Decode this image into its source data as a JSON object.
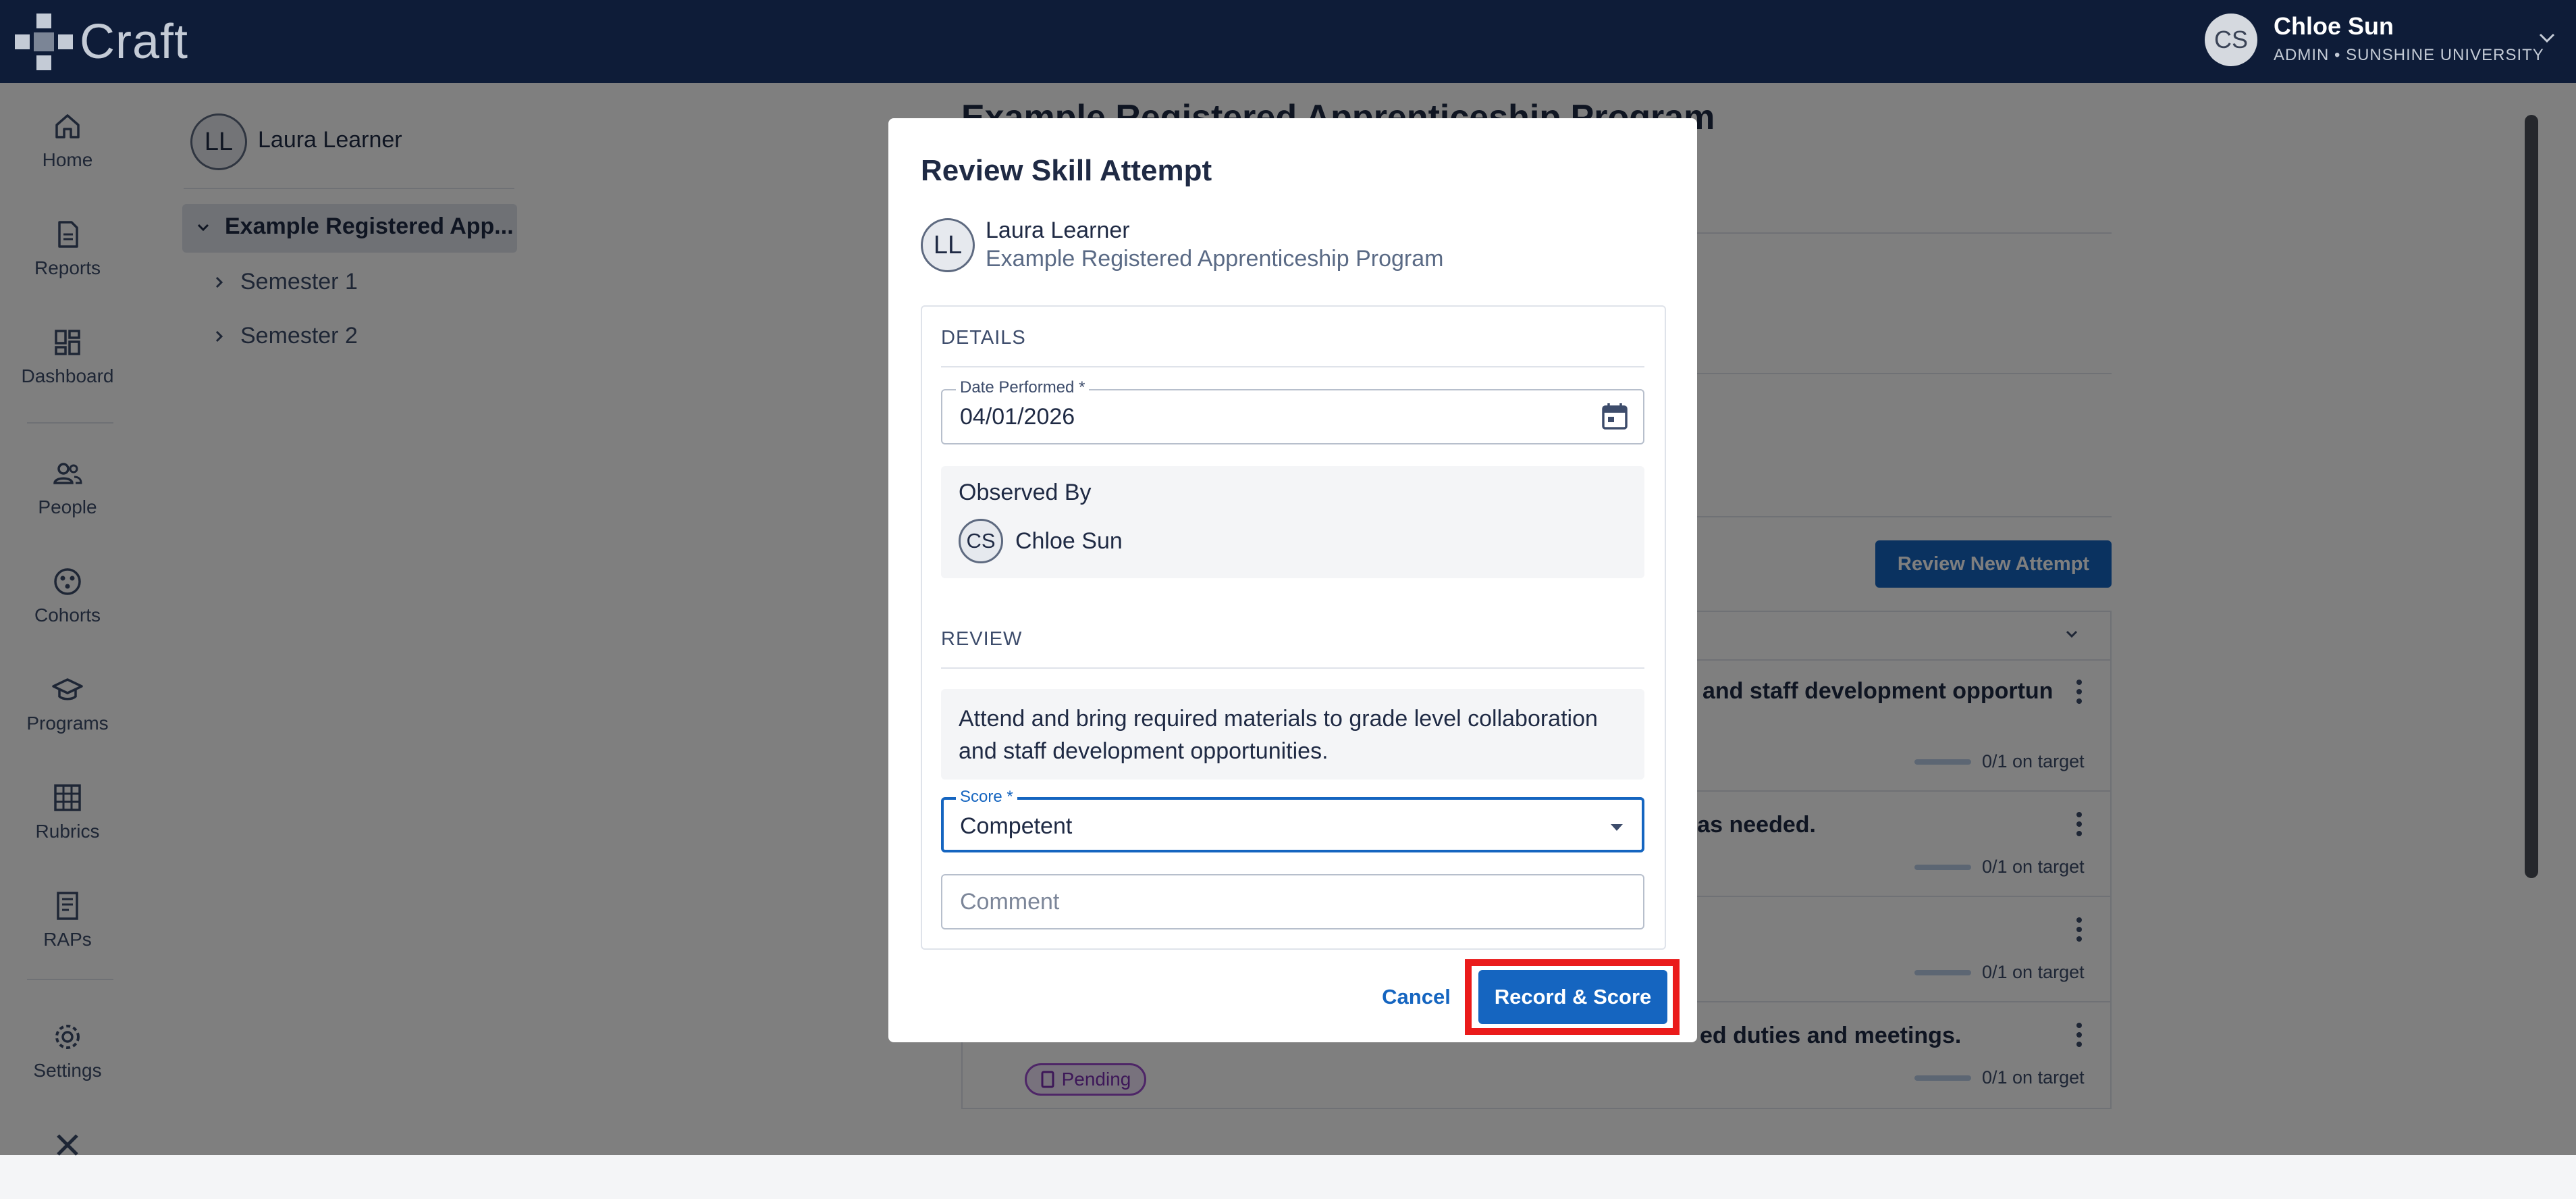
{
  "app": {
    "name": "Craft"
  },
  "user": {
    "initials": "CS",
    "name": "Chloe Sun",
    "role": "ADMIN • SUNSHINE UNIVERSITY"
  },
  "nav": {
    "home": "Home",
    "reports": "Reports",
    "dashboard": "Dashboard",
    "people": "People",
    "cohorts": "Cohorts",
    "programs": "Programs",
    "rubrics": "Rubrics",
    "raps": "RAPs",
    "settings": "Settings"
  },
  "learner_panel": {
    "initials": "LL",
    "name": "Laura Learner",
    "program": "Example Registered App...",
    "semesters": [
      "Semester 1",
      "Semester 2"
    ]
  },
  "main": {
    "title": "Example Registered Apprenticeship Program",
    "review_new_label": "Review New Attempt",
    "tasks": [
      {
        "text": "and staff development opportun",
        "progress": "0/1 on target"
      },
      {
        "text": "n as needed.",
        "progress": "0/1 on target"
      },
      {
        "text": "",
        "progress": "0/1 on target"
      },
      {
        "text": "ed duties and meetings.",
        "progress": "0/1 on target",
        "status": "Pending"
      }
    ]
  },
  "modal": {
    "title": "Review Skill Attempt",
    "learner": {
      "initials": "LL",
      "name": "Laura Learner",
      "program": "Example Registered Apprenticeship Program"
    },
    "details_label": "DETAILS",
    "date": {
      "label": "Date Performed *",
      "value": "04/01/2026"
    },
    "observed": {
      "label": "Observed By",
      "initials": "CS",
      "name": "Chloe Sun"
    },
    "review_label": "REVIEW",
    "skill_text": "Attend and bring required materials to grade level collaboration and staff development opportunities.",
    "score": {
      "label": "Score *",
      "value": "Competent"
    },
    "comment_placeholder": "Comment",
    "cancel_label": "Cancel",
    "submit_label": "Record & Score"
  }
}
